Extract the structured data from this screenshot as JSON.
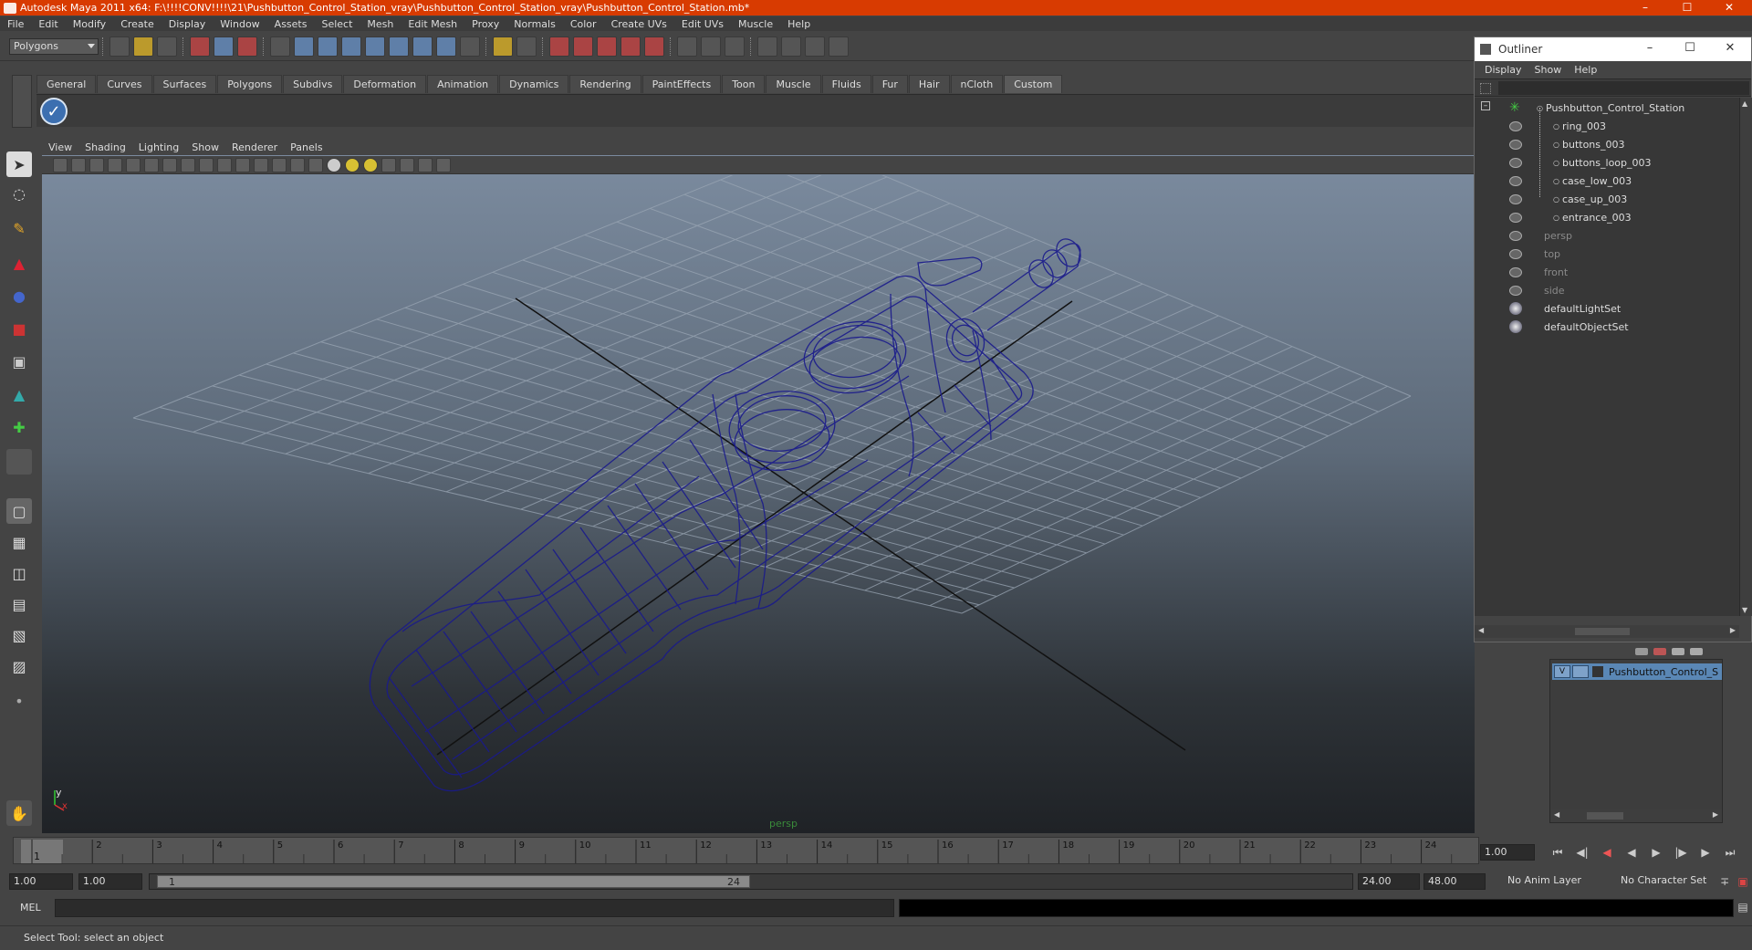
{
  "window": {
    "title": "Autodesk Maya 2011 x64: F:\\!!!!CONV!!!!\\21\\Pushbutton_Control_Station_vray\\Pushbutton_Control_Station_vray\\Pushbutton_Control_Station.mb*"
  },
  "menu": [
    "File",
    "Edit",
    "Modify",
    "Create",
    "Display",
    "Window",
    "Assets",
    "Select",
    "Mesh",
    "Edit Mesh",
    "Proxy",
    "Normals",
    "Color",
    "Create UVs",
    "Edit UVs",
    "Muscle",
    "Help"
  ],
  "toolbar": {
    "mode": "Polygons"
  },
  "shelf": {
    "tabs": [
      "General",
      "Curves",
      "Surfaces",
      "Polygons",
      "Subdivs",
      "Deformation",
      "Animation",
      "Dynamics",
      "Rendering",
      "PaintEffects",
      "Toon",
      "Muscle",
      "Fluids",
      "Fur",
      "Hair",
      "nCloth",
      "Custom"
    ],
    "active": "Custom"
  },
  "viewport": {
    "menu": [
      "View",
      "Shading",
      "Lighting",
      "Show",
      "Renderer",
      "Panels"
    ],
    "camera_label": "persp",
    "axis_y": "y",
    "axis_x": "x"
  },
  "timeline": {
    "ticks": [
      "1",
      "2",
      "3",
      "4",
      "5",
      "6",
      "7",
      "8",
      "9",
      "10",
      "11",
      "12",
      "13",
      "14",
      "15",
      "16",
      "17",
      "18",
      "19",
      "20",
      "21",
      "22",
      "23",
      "24"
    ],
    "current_frame": "1.00",
    "current_marker": "1"
  },
  "range": {
    "start": "1.00",
    "playback_start": "1.00",
    "slider_start": "1",
    "slider_end": "24",
    "playback_end": "24.00",
    "end": "48.00",
    "anim_layer": "No Anim Layer",
    "character_set": "No Character Set"
  },
  "mel": {
    "label": "MEL"
  },
  "status": {
    "text": "Select Tool: select an object"
  },
  "outliner": {
    "title": "Outliner",
    "menu": [
      "Display",
      "Show",
      "Help"
    ],
    "items": [
      {
        "name": "Pushbutton_Control_Station",
        "level": 0,
        "kind": "group"
      },
      {
        "name": "ring_003",
        "level": 1,
        "kind": "mesh"
      },
      {
        "name": "buttons_003",
        "level": 1,
        "kind": "mesh"
      },
      {
        "name": "buttons_loop_003",
        "level": 1,
        "kind": "mesh"
      },
      {
        "name": "case_low_003",
        "level": 1,
        "kind": "mesh"
      },
      {
        "name": "case_up_003",
        "level": 1,
        "kind": "mesh"
      },
      {
        "name": "entrance_003",
        "level": 1,
        "kind": "mesh"
      },
      {
        "name": "persp",
        "level": 0,
        "kind": "camera"
      },
      {
        "name": "top",
        "level": 0,
        "kind": "camera"
      },
      {
        "name": "front",
        "level": 0,
        "kind": "camera"
      },
      {
        "name": "side",
        "level": 0,
        "kind": "camera"
      },
      {
        "name": "defaultLightSet",
        "level": 0,
        "kind": "set"
      },
      {
        "name": "defaultObjectSet",
        "level": 0,
        "kind": "set"
      }
    ]
  },
  "layers": {
    "items": [
      {
        "visible": "V",
        "name": "Pushbutton_Control_Stat"
      }
    ]
  },
  "colors": {
    "titlebar": "#d83b01",
    "wire": "#1a1a8c",
    "layer_selected": "#5a87b5"
  }
}
